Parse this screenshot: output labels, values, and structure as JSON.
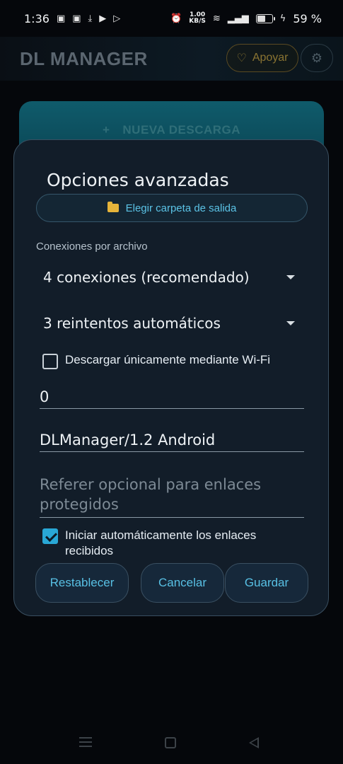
{
  "status_bar": {
    "time": "1:36",
    "speed_value": "1.00",
    "speed_unit": "KB/S",
    "battery_percent": "59 %",
    "battery_level": 0.59
  },
  "header": {
    "title": "DL MANAGER",
    "support_label": "Apoyar",
    "support_icon": "heart-outline-icon",
    "settings_icon": "gear-icon"
  },
  "main": {
    "new_download_icon": "+",
    "new_download_label": "NUEVA DESCARGA"
  },
  "dialog": {
    "title": "Opciones avanzadas",
    "folder_button_label": "Elegir carpeta de salida",
    "connections_label": "Conexiones por archivo",
    "connections_value": "4 conexiones (recomendado)",
    "retries_value": "3 reintentos automáticos",
    "wifi_only_label": "Descargar únicamente mediante Wi-Fi",
    "wifi_only_checked": false,
    "speed_limit_value": "0",
    "user_agent_value": "DLManager/1.2 Android",
    "referer_placeholder": "Referer opcional para enlaces protegidos",
    "auto_start_label": "Iniciar automáticamente los enlaces recibidos",
    "auto_start_checked": true,
    "reset_label": "Restablecer",
    "cancel_label": "Cancelar",
    "save_label": "Guardar"
  },
  "colors": {
    "accent": "#29a8d6",
    "dialog_bg": "#121d29",
    "support_gold": "#8a7432"
  }
}
